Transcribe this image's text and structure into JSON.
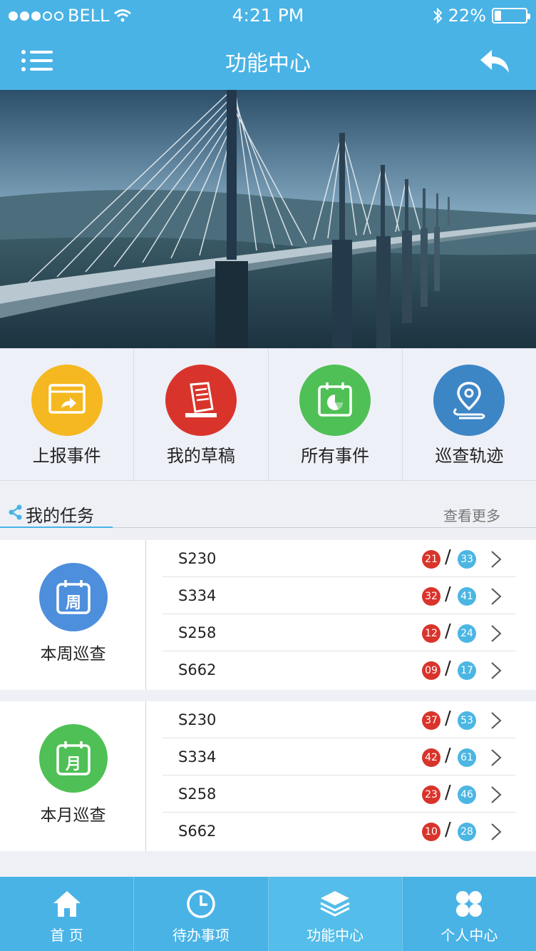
{
  "status_bar": {
    "carrier": "BELL",
    "time": "4:21 PM",
    "battery": "22%",
    "battery_level": 0.22
  },
  "nav": {
    "title": "功能中心",
    "menu_icon": "menu-icon",
    "back_icon": "back-icon"
  },
  "hero": {
    "image": "cable-stayed-bridge-photo"
  },
  "quick_actions": [
    {
      "label": "上报事件",
      "icon": "report-upload-icon",
      "color": "#f5b820"
    },
    {
      "label": "我的草稿",
      "icon": "draft-document-icon",
      "color": "#d9342b"
    },
    {
      "label": "所有事件",
      "icon": "calendar-chart-icon",
      "color": "#4fc055"
    },
    {
      "label": "巡查轨迹",
      "icon": "location-track-icon",
      "color": "#3d86c6"
    }
  ],
  "tasks": {
    "title": "我的任务",
    "more": "查看更多"
  },
  "groups": [
    {
      "name": "本周巡查",
      "badge": "周",
      "color": "#4d8fdc",
      "rows": [
        {
          "name": "S230",
          "done": "21",
          "total": "33"
        },
        {
          "name": "S334",
          "done": "32",
          "total": "41"
        },
        {
          "name": "S258",
          "done": "12",
          "total": "24"
        },
        {
          "name": "S662",
          "done": "09",
          "total": "17"
        }
      ]
    },
    {
      "name": "本月巡查",
      "badge": "月",
      "color": "#4fc055",
      "rows": [
        {
          "name": "S230",
          "done": "37",
          "total": "53"
        },
        {
          "name": "S334",
          "done": "42",
          "total": "61"
        },
        {
          "name": "S258",
          "done": "23",
          "total": "46"
        },
        {
          "name": "S662",
          "done": "10",
          "total": "28"
        }
      ]
    }
  ],
  "tabs": [
    {
      "label": "首 页",
      "icon": "home-icon"
    },
    {
      "label": "待办事项",
      "icon": "clock-icon"
    },
    {
      "label": "功能中心",
      "icon": "layers-icon",
      "active": true
    },
    {
      "label": "个人中心",
      "icon": "clover-icon"
    }
  ],
  "colors": {
    "primary": "#49b3e6",
    "badge_red": "#d9342b",
    "badge_blue": "#4cb6e3"
  }
}
